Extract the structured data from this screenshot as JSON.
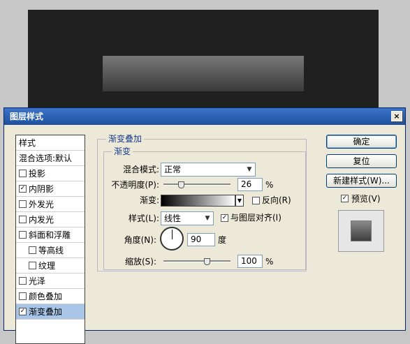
{
  "dialog": {
    "title": "图层样式",
    "close_glyph": "×"
  },
  "styles_list": {
    "header": "样式",
    "blend_options": "混合选项:默认",
    "items": [
      {
        "label": "投影",
        "checked": false,
        "mark": ""
      },
      {
        "label": "内阴影",
        "checked": true,
        "mark": "✓"
      },
      {
        "label": "外发光",
        "checked": false,
        "mark": ""
      },
      {
        "label": "内发光",
        "checked": false,
        "mark": ""
      },
      {
        "label": "斜面和浮雕",
        "checked": false,
        "mark": ""
      },
      {
        "label": "等高线",
        "checked": false,
        "mark": "",
        "indent": true
      },
      {
        "label": "纹理",
        "checked": false,
        "mark": "",
        "indent": true
      },
      {
        "label": "光泽",
        "checked": false,
        "mark": ""
      },
      {
        "label": "颜色叠加",
        "checked": false,
        "mark": ""
      },
      {
        "label": "渐变叠加",
        "checked": true,
        "mark": "✓",
        "selected": true
      }
    ]
  },
  "panel": {
    "outer_title": "渐变叠加",
    "inner_title": "渐变",
    "blend_mode_label": "混合模式:",
    "blend_mode_value": "正常",
    "opacity_label": "不透明度(P):",
    "opacity_value": "26",
    "opacity_fraction": 0.26,
    "opacity_unit": "%",
    "gradient_label": "渐变:",
    "reverse_label": "反向(R)",
    "style_label": "样式(L):",
    "style_value": "线性",
    "align_label": "与图层对齐(I)",
    "align_checked_mark": "✓",
    "angle_label": "角度(N):",
    "angle_value": "90",
    "angle_unit": "度",
    "scale_label": "缩放(S):",
    "scale_value": "100",
    "scale_unit": "%",
    "scale_fraction": 0.65
  },
  "buttons": {
    "ok": "确定",
    "reset": "复位",
    "new_style": "新建样式(W)...",
    "preview_label": "预览(V)",
    "preview_mark": "✓"
  },
  "icons": {
    "dropdown": "chevron-down-icon",
    "close": "close-icon"
  }
}
